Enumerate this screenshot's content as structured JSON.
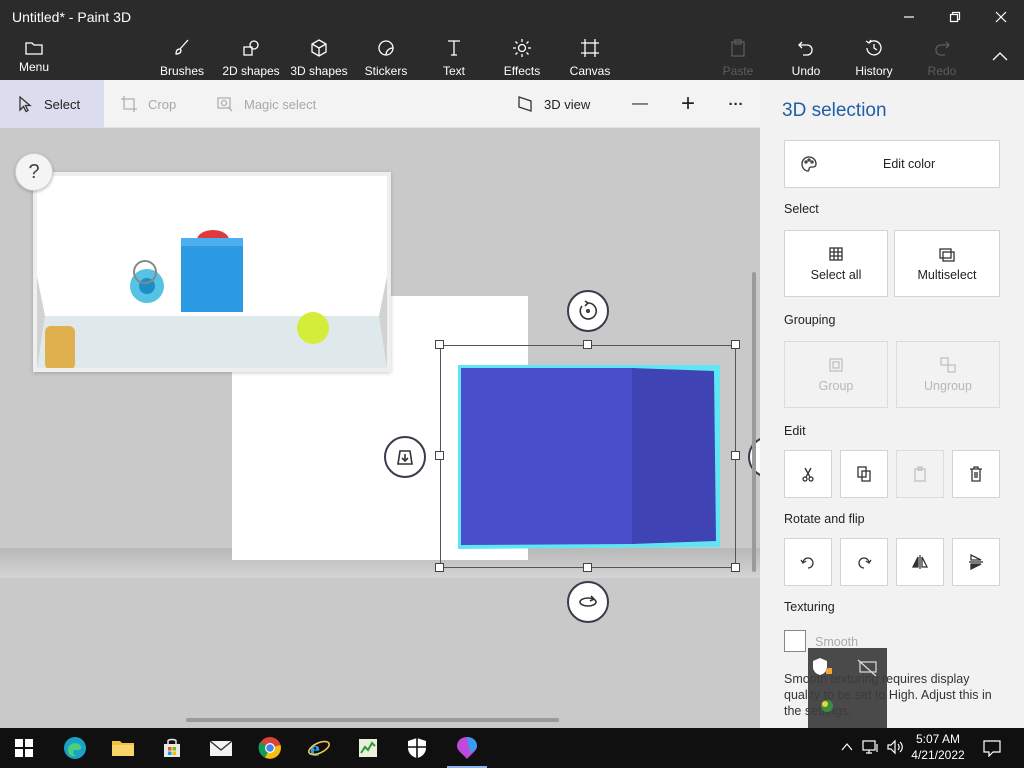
{
  "window": {
    "title": "Untitled* - Paint 3D"
  },
  "ribbon": {
    "menu": "Menu",
    "brushes": "Brushes",
    "shapes2d": "2D shapes",
    "shapes3d": "3D shapes",
    "stickers": "Stickers",
    "text": "Text",
    "effects": "Effects",
    "canvas": "Canvas",
    "paste": "Paste",
    "undo": "Undo",
    "history": "History",
    "redo": "Redo"
  },
  "toolbar": {
    "select": "Select",
    "crop": "Crop",
    "magic_select": "Magic select",
    "view3d": "3D view",
    "zoom_out": "—",
    "zoom_in": "+",
    "more": "···"
  },
  "canvas": {
    "help": "?"
  },
  "panel": {
    "title": "3D selection",
    "edit_color": "Edit color",
    "select_heading": "Select",
    "select_all": "Select all",
    "multiselect": "Multiselect",
    "grouping_heading": "Grouping",
    "group": "Group",
    "ungroup": "Ungroup",
    "edit_heading": "Edit",
    "rotate_heading": "Rotate and flip",
    "texturing_heading": "Texturing",
    "smooth": "Smooth",
    "smooth_note": "Smooth texturing requires display quality to be set to High. Adjust this in the settings."
  },
  "taskbar": {
    "time": "5:07 AM",
    "date": "4/21/2022"
  },
  "colors": {
    "accent": "#1f5fa8",
    "cube_front": "#4a4ecb",
    "cube_side": "#3f43b4",
    "selection_glow": "#5fe6f2"
  }
}
